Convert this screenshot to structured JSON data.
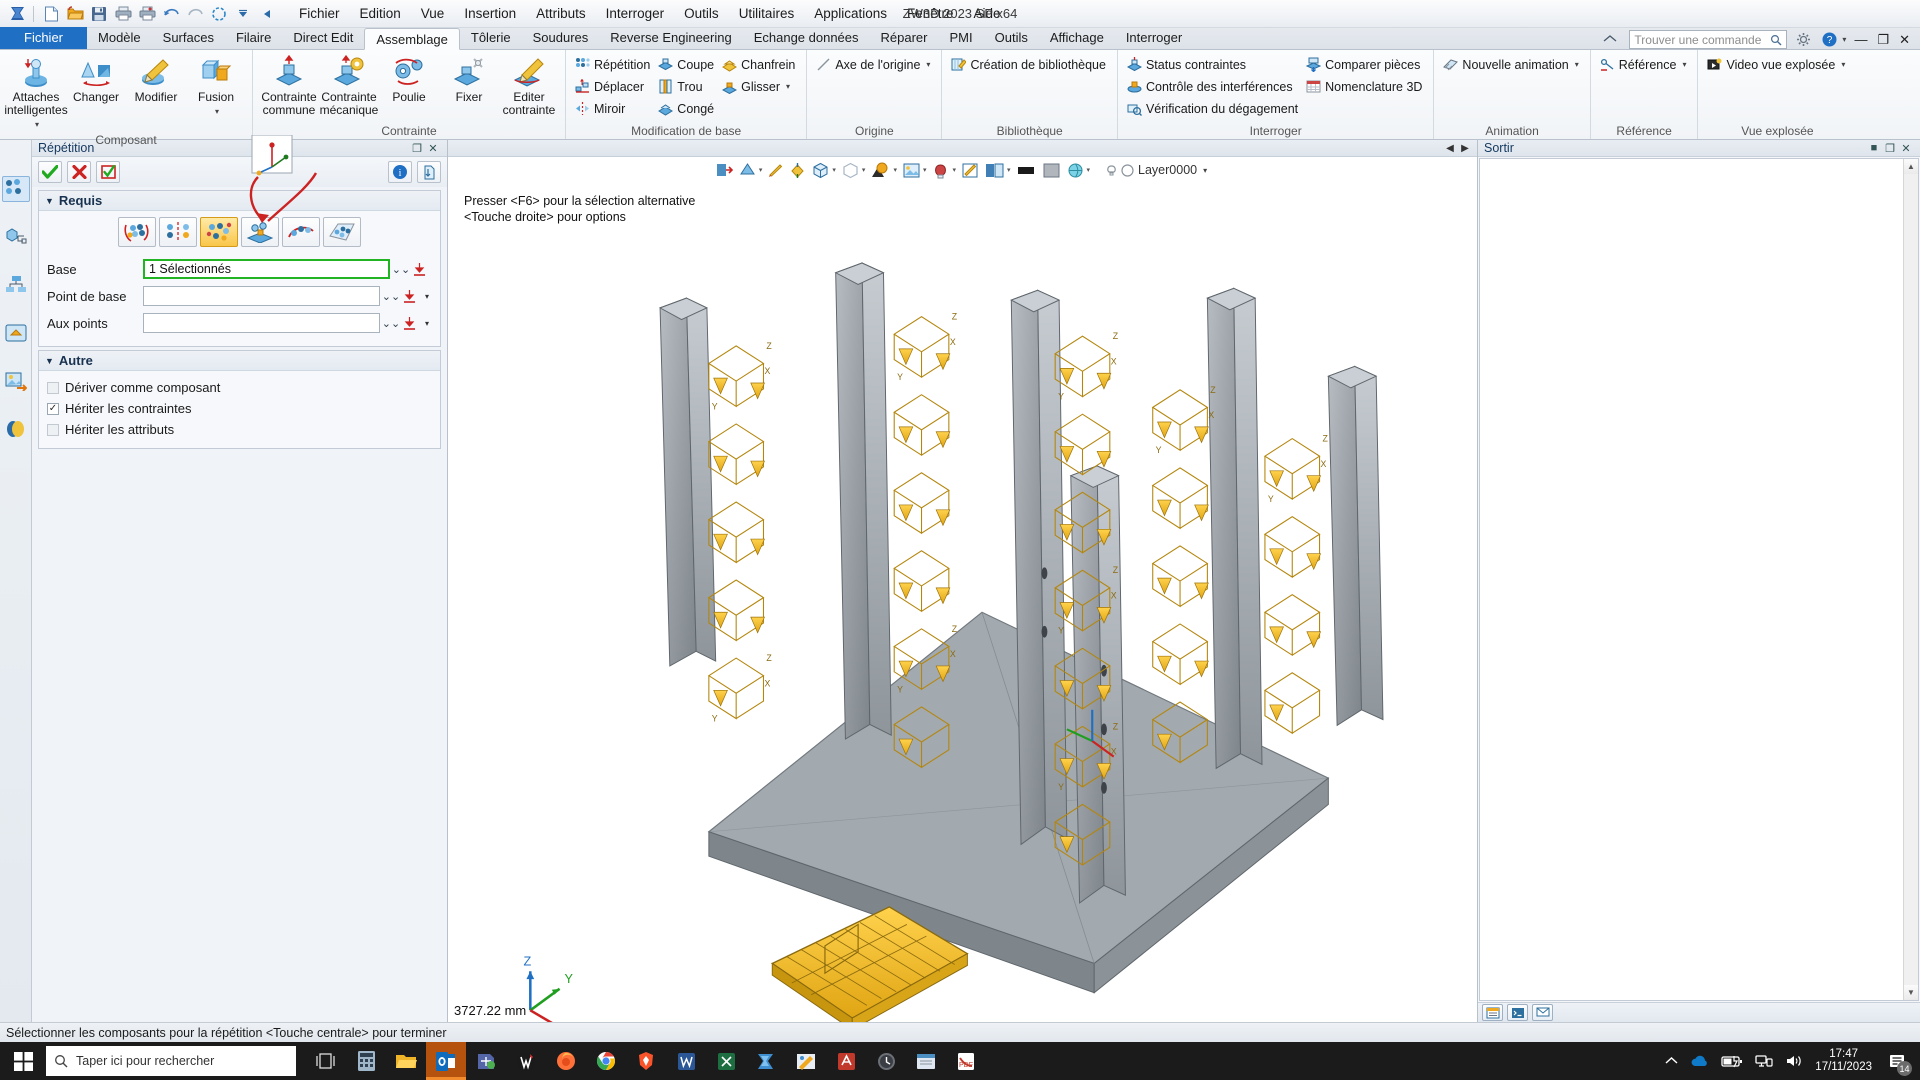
{
  "window": {
    "title": "ZW3D 2023 SP x64",
    "minimize": "—",
    "restore": "❐",
    "close": "✕"
  },
  "quick_access": {
    "icons": [
      "zw3d-logo-icon",
      "new-file-icon",
      "open-folder-icon",
      "save-icon",
      "print-icon",
      "print-preview-icon",
      "undo-icon",
      "redo-icon",
      "refresh-icon",
      "dropdown-icon",
      "back-icon"
    ]
  },
  "menubar": {
    "items": [
      "Fichier",
      "Edition",
      "Vue",
      "Insertion",
      "Attributs",
      "Interroger",
      "Outils",
      "Utilitaires",
      "Applications",
      "Fenêtre",
      "Aide"
    ]
  },
  "ribbon_tabs": {
    "file_tab": "Fichier",
    "items": [
      "Modèle",
      "Surfaces",
      "Filaire",
      "Direct Edit",
      "Assemblage",
      "Tôlerie",
      "Soudures",
      "Reverse Engineering",
      "Echange données",
      "Réparer",
      "PMI",
      "Outils",
      "Affichage",
      "Interroger"
    ],
    "active": "Assemblage",
    "search_placeholder": "Trouver une commande",
    "home_icon": "home-icon",
    "help_icon": "help-icon"
  },
  "ribbon": {
    "groups": [
      {
        "label": "Composant",
        "buttons": [
          {
            "label": "Attaches\nintelligentes",
            "icon": "smart-fastener-icon",
            "dropdown": true
          },
          {
            "label": "Changer",
            "icon": "change-component-icon",
            "dropdown": false
          },
          {
            "label": "Modifier",
            "icon": "edit-component-icon",
            "dropdown": false
          },
          {
            "label": "Fusion",
            "icon": "merge-icon",
            "dropdown": true
          }
        ]
      },
      {
        "label": "Contrainte",
        "dialog_launcher": true,
        "buttons": [
          {
            "label": "Contrainte\ncommune",
            "icon": "common-constraint-icon",
            "dropdown": false
          },
          {
            "label": "Contrainte\nmécanique",
            "icon": "mechanical-constraint-icon",
            "dropdown": false
          },
          {
            "label": "Poulie",
            "icon": "pulley-icon",
            "dropdown": false
          },
          {
            "label": "Fixer",
            "icon": "fix-icon",
            "dropdown": false
          },
          {
            "label": "Editer\ncontrainte",
            "icon": "edit-constraint-icon",
            "dropdown": false
          }
        ]
      },
      {
        "label": "Modification de base",
        "columns": [
          [
            {
              "label": "Répétition",
              "icon": "pattern-icon"
            },
            {
              "label": "Déplacer",
              "icon": "move-icon"
            },
            {
              "label": "Miroir",
              "icon": "mirror-icon"
            }
          ],
          [
            {
              "label": "Coupe",
              "icon": "cut-icon"
            },
            {
              "label": "Trou",
              "icon": "hole-icon"
            },
            {
              "label": "Congé",
              "icon": "fillet-icon"
            }
          ],
          [
            {
              "label": "Chanfrein",
              "icon": "chamfer-icon"
            },
            {
              "label": "Glisser",
              "icon": "drag-icon",
              "dropdown": true
            }
          ]
        ]
      },
      {
        "label": "Origine",
        "columns": [
          [
            {
              "label": "Axe de l'origine",
              "icon": "origin-axis-icon",
              "dropdown": true
            }
          ]
        ]
      },
      {
        "label": "Bibliothèque",
        "dialog_launcher": true,
        "columns": [
          [
            {
              "label": "Création de bibliothèque",
              "icon": "library-create-icon"
            }
          ]
        ]
      },
      {
        "label": "Interroger",
        "columns": [
          [
            {
              "label": "Status contraintes",
              "icon": "constraint-status-icon"
            },
            {
              "label": "Contrôle des interférences",
              "icon": "interference-check-icon"
            },
            {
              "label": "Vérification du dégagement",
              "icon": "clearance-check-icon"
            }
          ],
          [
            {
              "label": "Comparer pièces",
              "icon": "compare-parts-icon"
            },
            {
              "label": "Nomenclature 3D",
              "icon": "bom-3d-icon"
            }
          ]
        ]
      },
      {
        "label": "Animation",
        "columns": [
          [
            {
              "label": "Nouvelle animation",
              "icon": "new-animation-icon",
              "dropdown": true
            }
          ]
        ]
      },
      {
        "label": "Référence",
        "columns": [
          [
            {
              "label": "Référence",
              "icon": "reference-icon",
              "dropdown": true
            }
          ]
        ]
      },
      {
        "label": "Vue explosée",
        "columns": [
          [
            {
              "label": "Video vue explosée",
              "icon": "explode-video-icon",
              "dropdown": true
            }
          ]
        ]
      }
    ]
  },
  "left_strip": {
    "items": [
      {
        "name": "assembly-pattern-icon",
        "selected": true
      },
      {
        "name": "part-tree-icon",
        "selected": false
      },
      {
        "name": "hierarchy-icon",
        "selected": false
      },
      {
        "name": "shape-manager-icon",
        "selected": false
      },
      {
        "name": "image-export-icon",
        "selected": false
      },
      {
        "name": "visualize-icon",
        "selected": false
      }
    ]
  },
  "left_panel": {
    "title": "Répétition",
    "restore_btn": "❐",
    "close_btn": "✕",
    "commands": {
      "ok": "ok-check-button",
      "cancel": "cancel-cross-button",
      "apply": "apply-button",
      "info": "info-button",
      "settings": "panel-options-button"
    },
    "sections": [
      {
        "title": "Requis",
        "expanded": true,
        "pattern_types": [
          {
            "name": "linear-pattern-type",
            "active": false
          },
          {
            "name": "circular-pattern-type",
            "active": false
          },
          {
            "name": "point-to-point-pattern-type",
            "active": true
          },
          {
            "name": "at-points-pattern-type",
            "active": false
          },
          {
            "name": "curve-pattern-type",
            "active": false
          },
          {
            "name": "face-pattern-type",
            "active": false
          }
        ],
        "fields": [
          {
            "label": "Base",
            "value": "1 Sélectionnés",
            "focused": true,
            "has_caret_menu": false
          },
          {
            "label": "Point de base",
            "value": "",
            "focused": false,
            "has_caret_menu": true
          },
          {
            "label": "Aux points",
            "value": "",
            "focused": false,
            "has_caret_menu": true
          }
        ]
      },
      {
        "title": "Autre",
        "expanded": true,
        "checkboxes": [
          {
            "label": "Dériver comme composant",
            "checked": false,
            "enabled": false
          },
          {
            "label": "Hériter les contraintes",
            "checked": true,
            "enabled": true
          },
          {
            "label": "Hériter les attributs",
            "checked": false,
            "enabled": false
          }
        ]
      }
    ]
  },
  "viewport": {
    "toolbar_icons": [
      "exit-view-icon",
      "shade-mode-icon",
      "line-style-icon",
      "visual-style-icon",
      "render-mode-icon",
      "transparent-icon",
      "section-icon",
      "background-icon",
      "light-icon",
      "rotate-view-icon",
      "sketch-icon",
      "display-mode-icon",
      "color-swatch-icon",
      "material-icon",
      "env-icon"
    ],
    "layer": {
      "label": "Layer0000",
      "bulb_icon": "bulb-icon",
      "layer-icon": "layer-icon"
    },
    "hint": "Presser <F6> pour la sélection alternative\n<Touche droite> pour options",
    "dimension_label": "3727.22 mm",
    "triad": {
      "x": "X",
      "y": "Y",
      "z": "Z"
    },
    "nav_prev": "◀",
    "nav_next": "▶"
  },
  "right_panel": {
    "title": "Sortir",
    "buttons": {
      "stop": "■",
      "restore": "❐",
      "close": "✕"
    },
    "footer_icons": [
      "output-window-icon",
      "terminal-icon",
      "message-icon"
    ]
  },
  "status_bar": {
    "message": "Sélectionner les composants pour la répétition  <Touche centrale> pour terminer"
  },
  "taskbar": {
    "start_icon": "windows-start-icon",
    "search_placeholder": "Taper ici pour rechercher",
    "search_icon": "search-icon",
    "apps": [
      {
        "name": "task-view-icon",
        "active": false
      },
      {
        "name": "calculator-icon",
        "active": false
      },
      {
        "name": "file-explorer-icon",
        "active": false
      },
      {
        "name": "outlook-icon",
        "active": true
      },
      {
        "name": "teamviewer-icon",
        "active": false
      },
      {
        "name": "wps-writer-icon",
        "active": false
      },
      {
        "name": "firefox-icon",
        "active": false
      },
      {
        "name": "chrome-icon",
        "active": false
      },
      {
        "name": "brave-icon",
        "active": false
      },
      {
        "name": "word-icon",
        "active": false
      },
      {
        "name": "excel-icon",
        "active": false
      },
      {
        "name": "zw3d-icon",
        "active": false
      },
      {
        "name": "sketch-app-icon",
        "active": false
      },
      {
        "name": "autocad-icon",
        "active": false
      },
      {
        "name": "clock-app-icon",
        "active": false
      },
      {
        "name": "explorer2-icon",
        "active": false
      },
      {
        "name": "pdf-icon",
        "active": false
      }
    ],
    "tray": {
      "chevron": "chevron-up-icon",
      "icons": [
        "onedrive-icon",
        "battery-icon",
        "network-icon",
        "volume-icon"
      ],
      "time": "17:47",
      "date": "17/11/2023",
      "notification_count": "14"
    }
  },
  "colors": {
    "accent_blue": "#1f6fc4",
    "ribbon_bg": "#f1f4f7",
    "panel_bg": "#f0f3f7",
    "active_yellow": "#f9c64a",
    "green_ok": "#22b422",
    "red_cancel": "#cc2222",
    "model_gray": "#9aa1a6",
    "pattern_gold": "#b4860d",
    "taskbar_bg": "#1b1b1b"
  }
}
